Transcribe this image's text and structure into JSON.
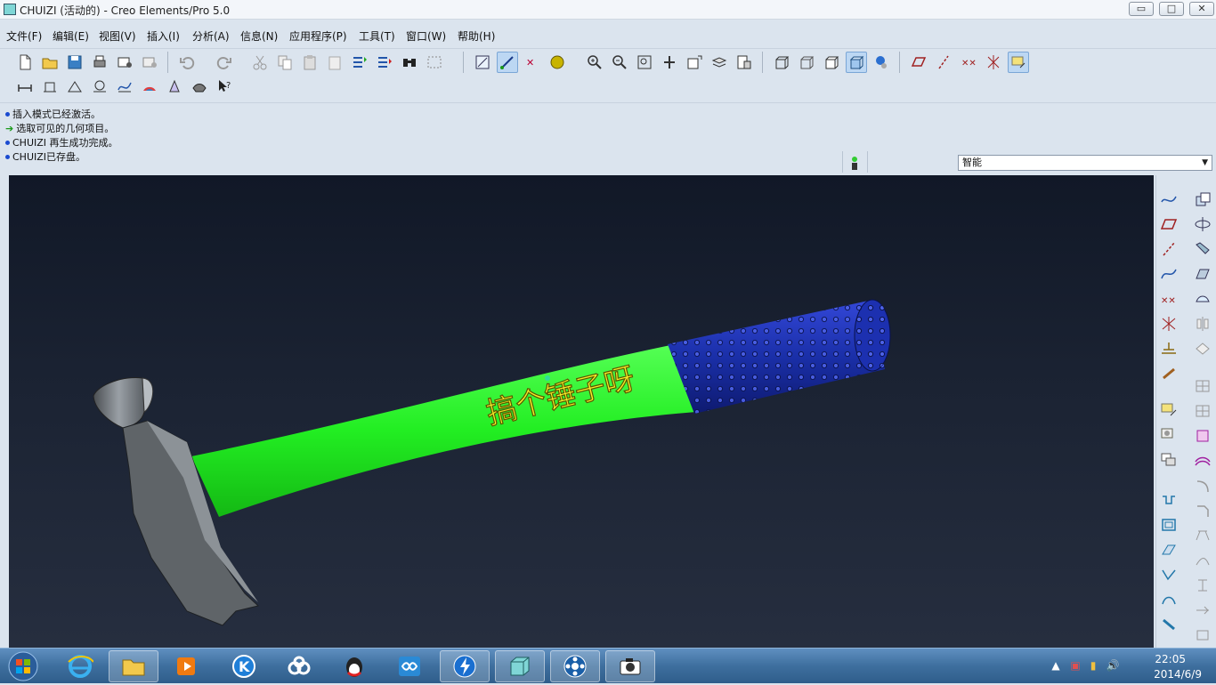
{
  "window": {
    "title": "CHUIZI (活动的) - Creo Elements/Pro 5.0",
    "minimize": "▭",
    "maximize": "□",
    "close": "✕"
  },
  "menu": [
    "文件(F)",
    "编辑(E)",
    "视图(V)",
    "插入(I)",
    "分析(A)",
    "信息(N)",
    "应用程序(P)",
    "工具(T)",
    "窗口(W)",
    "帮助(H)"
  ],
  "messages": [
    {
      "kind": "info",
      "text": "插入模式已经激活。"
    },
    {
      "kind": "prompt",
      "text": "选取可见的几何项目。"
    },
    {
      "kind": "info",
      "text": "CHUIZI 再生成功完成。"
    },
    {
      "kind": "info",
      "text": "CHUIZI已存盘。"
    }
  ],
  "filter": {
    "selected": "智能"
  },
  "model": {
    "embossed_text": "搞个锤子呀",
    "handle_color": "#22ee22",
    "grip_color": "#1a2fa8",
    "head_color": "#8a9096",
    "background_top": "#111827",
    "background_bottom": "#262e3f"
  },
  "taskbar": {
    "time": "22:05",
    "date": "2014/6/9"
  }
}
